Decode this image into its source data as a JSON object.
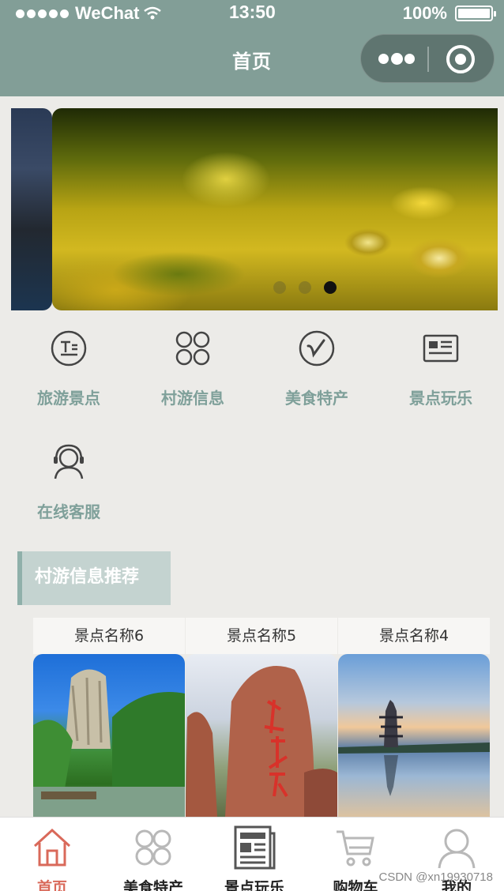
{
  "status_bar": {
    "carrier": "WeChat",
    "time": "13:50",
    "battery": "100%"
  },
  "navbar": {
    "title": "首页",
    "more_icon": "more-dots-icon",
    "close_icon": "target-circle-icon"
  },
  "swiper": {
    "slide_count": 3,
    "active_index": 2
  },
  "categories": [
    {
      "label": "旅游景点",
      "icon": "text-doc-icon"
    },
    {
      "label": "村游信息",
      "icon": "four-circles-icon"
    },
    {
      "label": "美食特产",
      "icon": "v-circle-icon"
    },
    {
      "label": "景点玩乐",
      "icon": "news-card-icon"
    },
    {
      "label": "在线客服",
      "icon": "headset-user-icon"
    }
  ],
  "section": {
    "title": "村游信息推荐"
  },
  "cards": [
    {
      "title": "景点名称6"
    },
    {
      "title": "景点名称5"
    },
    {
      "title": "景点名称4"
    }
  ],
  "tabbar": [
    {
      "label": "首页",
      "icon": "home-icon",
      "active": true
    },
    {
      "label": "美食特产",
      "icon": "four-circles-icon",
      "active": false
    },
    {
      "label": "景点玩乐",
      "icon": "newspaper-icon",
      "active": false
    },
    {
      "label": "购物车",
      "icon": "cart-icon",
      "active": false
    },
    {
      "label": "我的",
      "icon": "user-icon",
      "active": false
    }
  ],
  "watermark": "CSDN @xn19930718",
  "colors": {
    "navbar_bg": "#829e97",
    "accent_label": "#7fa09a",
    "tab_active": "#d9695a"
  }
}
